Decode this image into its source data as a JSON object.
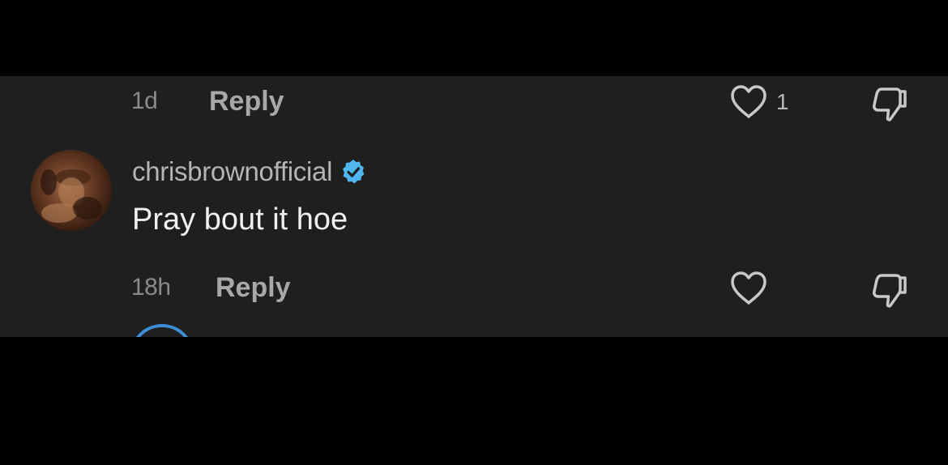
{
  "top_comment_meta": {
    "time": "1d",
    "reply_label": "Reply",
    "like_count": "1",
    "like_icon": "heart-outline-icon",
    "dislike_icon": "thumbs-down-icon"
  },
  "comment": {
    "username": "chrisbrownofficial",
    "verified_icon": "verified-badge-icon",
    "verified_color": "#4fb6f0",
    "text": "Pray bout it hoe",
    "time": "18h",
    "reply_label": "Reply",
    "like_icon": "heart-outline-icon",
    "dislike_icon": "thumbs-down-icon"
  },
  "colors": {
    "background": "#000000",
    "panel": "#1f1f1f",
    "secondary_text": "#8a8a8a",
    "primary_text": "#f0f0f0"
  }
}
